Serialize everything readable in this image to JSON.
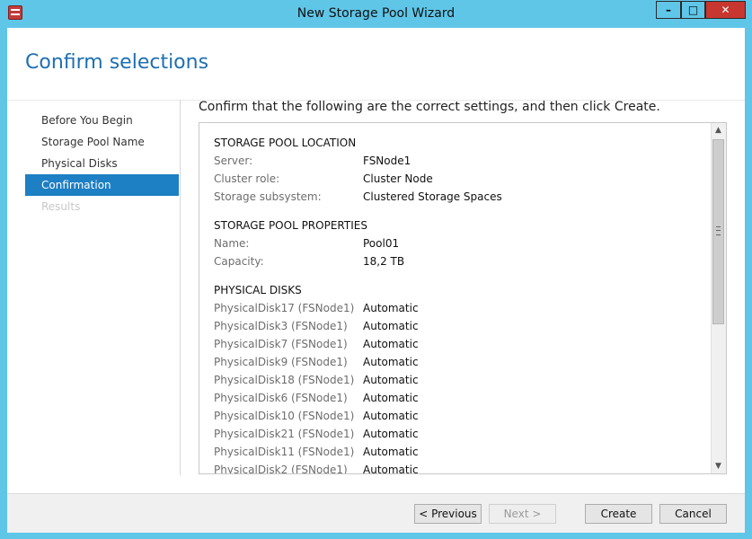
{
  "window": {
    "title": "New Storage Pool Wizard",
    "controls": {
      "minimize": "–",
      "maximize": "□",
      "close": "✕"
    }
  },
  "header": {
    "title": "Confirm selections"
  },
  "sidebar": {
    "items": [
      {
        "label": "Before You Begin",
        "state": "normal"
      },
      {
        "label": "Storage Pool Name",
        "state": "normal"
      },
      {
        "label": "Physical Disks",
        "state": "normal"
      },
      {
        "label": "Confirmation",
        "state": "active"
      },
      {
        "label": "Results",
        "state": "disabled"
      }
    ]
  },
  "main": {
    "instruction": "Confirm that the following are the correct settings, and then click Create.",
    "location": {
      "title": "STORAGE POOL LOCATION",
      "rows": [
        {
          "label": "Server:",
          "value": "FSNode1"
        },
        {
          "label": "Cluster role:",
          "value": "Cluster Node"
        },
        {
          "label": "Storage subsystem:",
          "value": "Clustered Storage Spaces"
        }
      ]
    },
    "properties": {
      "title": "STORAGE POOL PROPERTIES",
      "rows": [
        {
          "label": "Name:",
          "value": "Pool01"
        },
        {
          "label": "Capacity:",
          "value": "18,2 TB"
        }
      ]
    },
    "disks": {
      "title": "PHYSICAL DISKS",
      "rows": [
        {
          "label": "PhysicalDisk17 (FSNode1)",
          "value": "Automatic"
        },
        {
          "label": "PhysicalDisk3 (FSNode1)",
          "value": "Automatic"
        },
        {
          "label": "PhysicalDisk7 (FSNode1)",
          "value": "Automatic"
        },
        {
          "label": "PhysicalDisk9 (FSNode1)",
          "value": "Automatic"
        },
        {
          "label": "PhysicalDisk18 (FSNode1)",
          "value": "Automatic"
        },
        {
          "label": "PhysicalDisk6 (FSNode1)",
          "value": "Automatic"
        },
        {
          "label": "PhysicalDisk10 (FSNode1)",
          "value": "Automatic"
        },
        {
          "label": "PhysicalDisk21 (FSNode1)",
          "value": "Automatic"
        },
        {
          "label": "PhysicalDisk11 (FSNode1)",
          "value": "Automatic"
        },
        {
          "label": "PhysicalDisk2 (FSNode1)",
          "value": "Automatic"
        }
      ]
    }
  },
  "footer": {
    "previous": "< Previous",
    "next": "Next >",
    "create": "Create",
    "cancel": "Cancel"
  },
  "colors": {
    "frame": "#5fc6e8",
    "accent": "#1d7fc4",
    "title_text": "#1e6fb3",
    "close_button": "#c7372f"
  }
}
